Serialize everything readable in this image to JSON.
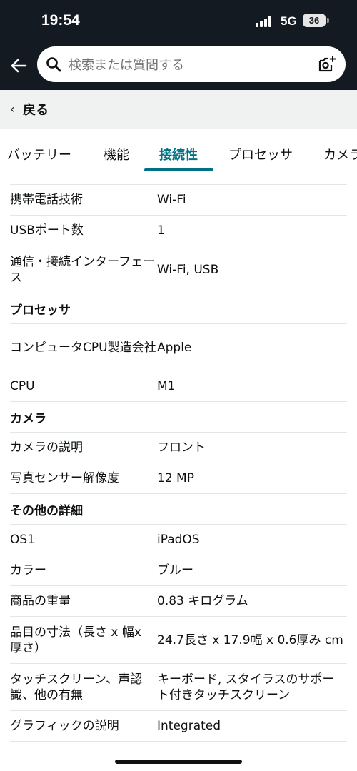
{
  "status_bar": {
    "time": "19:54",
    "network": "5G",
    "battery": "36"
  },
  "search": {
    "placeholder": "検索または質問する"
  },
  "back_bar": {
    "label": "戻る"
  },
  "tabs": [
    "バッテリー",
    "機能",
    "接続性",
    "プロセッサ",
    "カメラ"
  ],
  "active_tab": "接続性",
  "specs": [
    {
      "type": "row",
      "key": "携帯電話技術",
      "value": "Wi-Fi"
    },
    {
      "type": "row",
      "key": "USBポート数",
      "value": "1"
    },
    {
      "type": "row",
      "key": "通信・接続インターフェース",
      "value": "Wi-Fi, USB"
    },
    {
      "type": "section",
      "title": "プロセッサ"
    },
    {
      "type": "row",
      "key": "コンピュータCPU製造会社",
      "value": "Apple"
    },
    {
      "type": "row",
      "key": "CPU",
      "value": "M1"
    },
    {
      "type": "section",
      "title": "カメラ"
    },
    {
      "type": "row",
      "key": "カメラの説明",
      "value": "フロント"
    },
    {
      "type": "row",
      "key": "写真センサー解像度",
      "value": "12 MP"
    },
    {
      "type": "section",
      "title": "その他の詳細"
    },
    {
      "type": "row",
      "key": "OS1",
      "value": "iPadOS"
    },
    {
      "type": "row",
      "key": "カラー",
      "value": "ブルー"
    },
    {
      "type": "row",
      "key": "商品の重量",
      "value": "0.83 キログラム"
    },
    {
      "type": "row",
      "key": "品目の寸法（長さ x 幅x 厚さ）",
      "value": "24.7長さ x 17.9幅 x 0.6厚み cm"
    },
    {
      "type": "row",
      "key": "タッチスクリーン、声認識、他の有無",
      "value": "キーボード, スタイラスのサポート付きタッチスクリーン"
    },
    {
      "type": "row",
      "key": "グラフィックの説明",
      "value": "Integrated"
    }
  ]
}
